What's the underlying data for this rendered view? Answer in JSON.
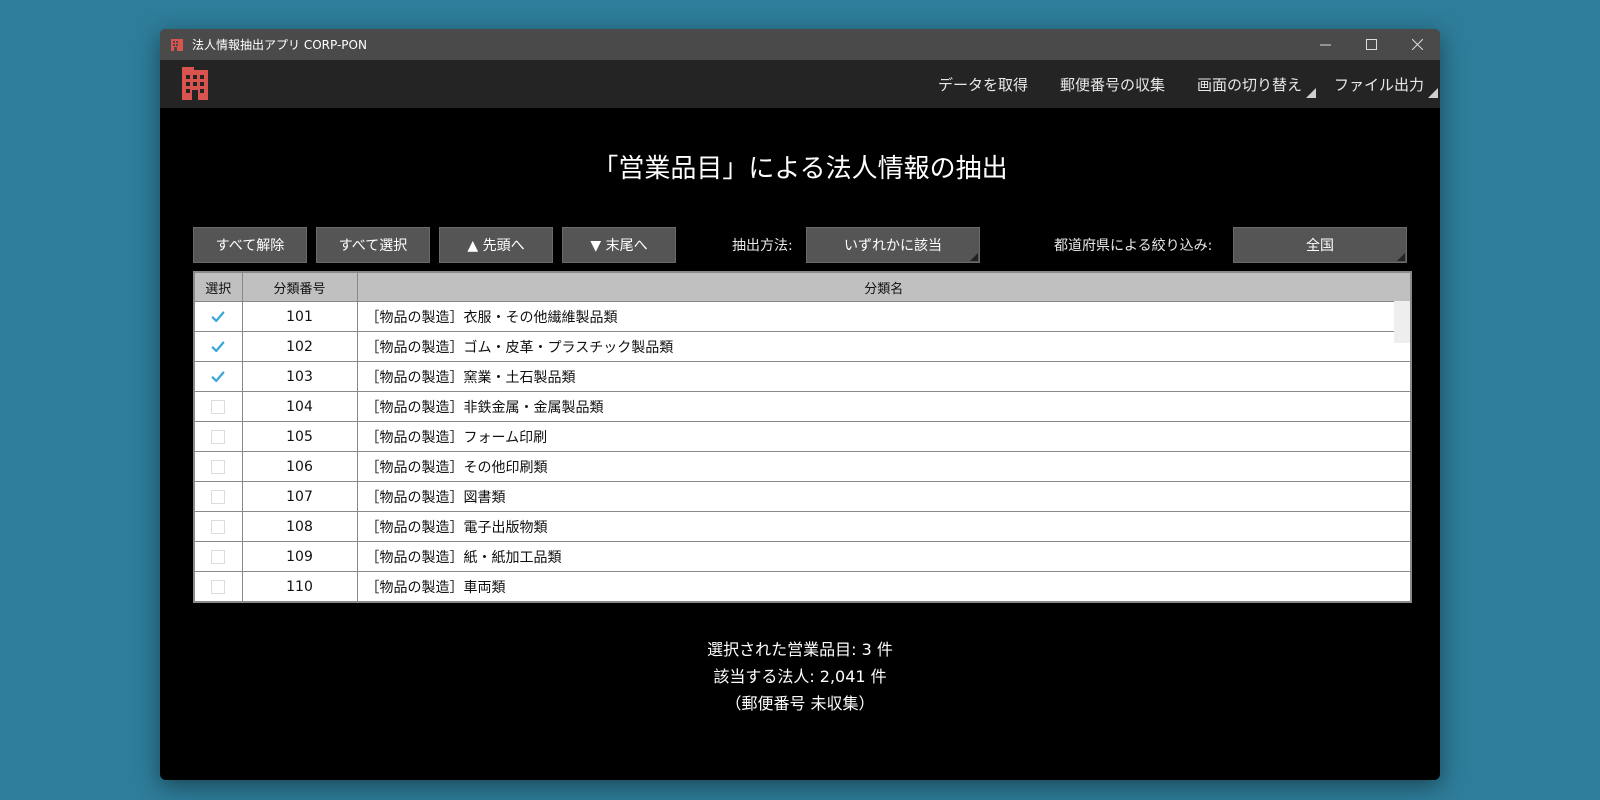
{
  "window": {
    "title": "法人情報抽出アプリ CORP-PON",
    "controls": [
      "minimize-icon",
      "maximize-icon",
      "close-icon"
    ]
  },
  "menu": {
    "get_data": "データを取得",
    "collect_postal": "郵便番号の収集",
    "switch_screen": "画面の切り替え",
    "file_output": "ファイル出力"
  },
  "page": {
    "title": "「営業品目」による法人情報の抽出"
  },
  "toolbar": {
    "clear_all": "すべて解除",
    "select_all": "すべて選択",
    "to_top": "▲ 先頭へ",
    "to_bottom": "▼ 末尾へ",
    "method_label": "抽出方法:",
    "method_value": "いずれかに該当",
    "pref_label": "都道府県による絞り込み:",
    "pref_value": "全国"
  },
  "table": {
    "headers": {
      "select": "選択",
      "code": "分類番号",
      "name": "分類名"
    },
    "rows": [
      {
        "checked": true,
        "code": "101",
        "name": "［物品の製造］衣服・その他繊維製品類"
      },
      {
        "checked": true,
        "code": "102",
        "name": "［物品の製造］ゴム・皮革・プラスチック製品類"
      },
      {
        "checked": true,
        "code": "103",
        "name": "［物品の製造］窯業・土石製品類"
      },
      {
        "checked": false,
        "code": "104",
        "name": "［物品の製造］非鉄金属・金属製品類"
      },
      {
        "checked": false,
        "code": "105",
        "name": "［物品の製造］フォーム印刷"
      },
      {
        "checked": false,
        "code": "106",
        "name": "［物品の製造］その他印刷類"
      },
      {
        "checked": false,
        "code": "107",
        "name": "［物品の製造］図書類"
      },
      {
        "checked": false,
        "code": "108",
        "name": "［物品の製造］電子出版物類"
      },
      {
        "checked": false,
        "code": "109",
        "name": "［物品の製造］紙・紙加工品類"
      },
      {
        "checked": false,
        "code": "110",
        "name": "［物品の製造］車両類"
      }
    ]
  },
  "summary": {
    "selected": "選択された営業品目: 3 件",
    "matched": "該当する法人: 2,041 件",
    "postal_note": "（郵便番号 未収集）"
  },
  "colors": {
    "desktop": "#2e7d9a",
    "titlebar": "#4a4a4a",
    "menubar": "#242424",
    "check": "#3aa7d9",
    "logo": "#d9534f"
  }
}
